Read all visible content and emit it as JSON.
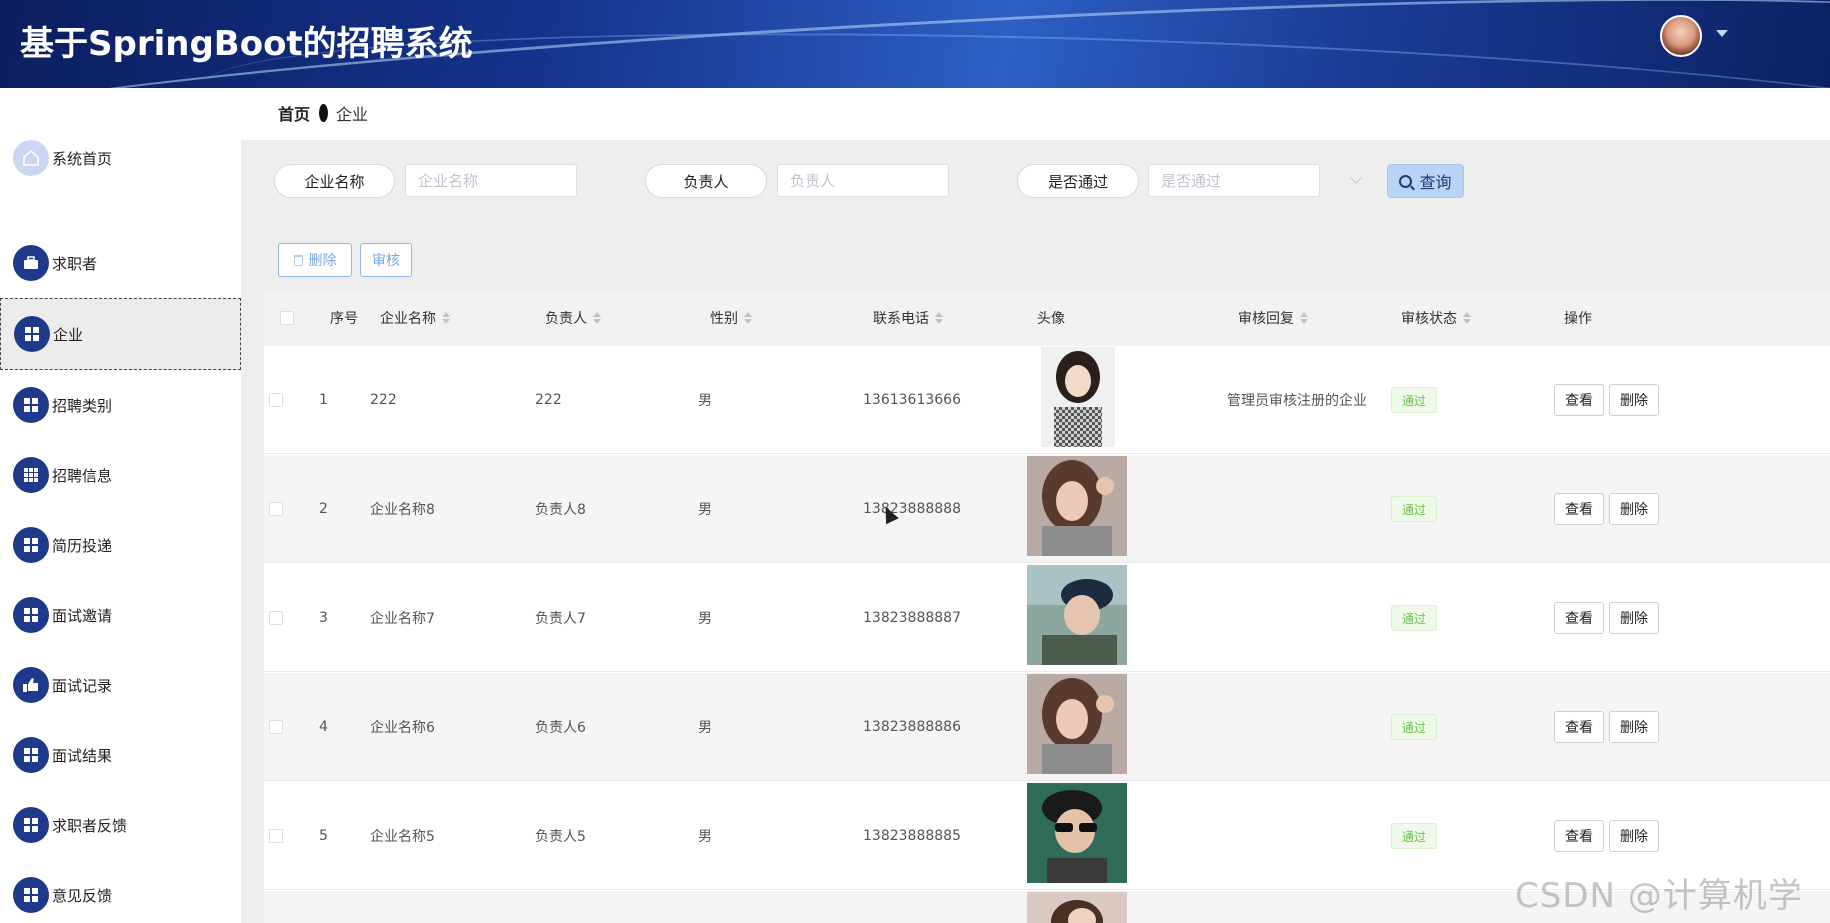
{
  "header": {
    "title": "基于SpringBoot的招聘系统"
  },
  "breadcrumb": {
    "home": "首页",
    "current": "企业"
  },
  "sidebar": {
    "items": [
      {
        "label": "系统首页",
        "icon": "home-icon"
      },
      {
        "label": "求职者",
        "icon": "briefcase-icon"
      },
      {
        "label": "企业",
        "icon": "grid-icon",
        "active": true
      },
      {
        "label": "招聘类别",
        "icon": "grid-icon"
      },
      {
        "label": "招聘信息",
        "icon": "table-icon"
      },
      {
        "label": "简历投递",
        "icon": "grid-icon"
      },
      {
        "label": "面试邀请",
        "icon": "grid-icon"
      },
      {
        "label": "面试记录",
        "icon": "thumb-icon"
      },
      {
        "label": "面试结果",
        "icon": "grid-icon"
      },
      {
        "label": "求职者反馈",
        "icon": "grid-icon"
      },
      {
        "label": "意见反馈",
        "icon": "grid-icon"
      }
    ]
  },
  "search": {
    "company_label": "企业名称",
    "company_placeholder": "企业名称",
    "manager_label": "负责人",
    "manager_placeholder": "负责人",
    "approved_label": "是否通过",
    "approved_placeholder": "是否通过",
    "query_label": "查询"
  },
  "toolbar": {
    "delete_label": "删除",
    "audit_label": "审核"
  },
  "table": {
    "columns": [
      "序号",
      "企业名称",
      "负责人",
      "性别",
      "联系电话",
      "头像",
      "审核回复",
      "审核状态",
      "操作"
    ],
    "rows": [
      {
        "index": "1",
        "company": "222",
        "manager": "222",
        "gender": "男",
        "phone": "13613613666",
        "reply": "管理员审核注册的企业",
        "status": "通过"
      },
      {
        "index": "2",
        "company": "企业名称8",
        "manager": "负责人8",
        "gender": "男",
        "phone": "13823888888",
        "reply": "",
        "status": "通过"
      },
      {
        "index": "3",
        "company": "企业名称7",
        "manager": "负责人7",
        "gender": "男",
        "phone": "13823888887",
        "reply": "",
        "status": "通过"
      },
      {
        "index": "4",
        "company": "企业名称6",
        "manager": "负责人6",
        "gender": "男",
        "phone": "13823888886",
        "reply": "",
        "status": "通过"
      },
      {
        "index": "5",
        "company": "企业名称5",
        "manager": "负责人5",
        "gender": "男",
        "phone": "13823888885",
        "reply": "",
        "status": "通过"
      }
    ],
    "view_label": "查看",
    "delete_label": "删除"
  },
  "watermark": "CSDN @计算机学姐",
  "colors": {
    "header": "#15338c",
    "icon_bg": "#1f3a8a",
    "query_bg": "#b8d4f5",
    "status_green": "#6ac04a"
  }
}
